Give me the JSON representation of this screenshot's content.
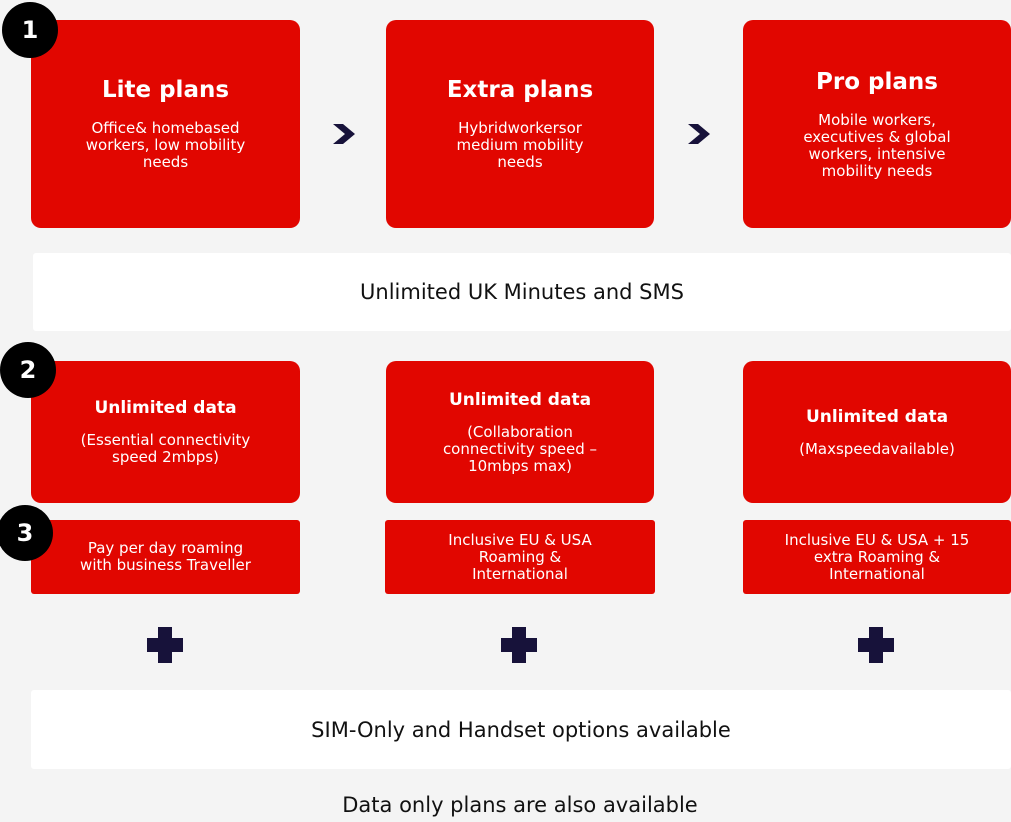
{
  "steps": [
    "1",
    "2",
    "3"
  ],
  "plans": [
    {
      "title": "Lite plans",
      "lines": [
        "Office& homebased",
        "workers, low mobility",
        "needs"
      ]
    },
    {
      "title": "Extra plans",
      "lines": [
        "Hybridworkersor",
        "medium mobility",
        "needs"
      ]
    },
    {
      "title": "Pro plans",
      "lines": [
        "Mobile workers,",
        "executives & global",
        "workers, intensive",
        "mobility needs"
      ]
    }
  ],
  "minutes_banner": "Unlimited UK Minutes and SMS",
  "data_tiers": [
    {
      "title": "Unlimited data",
      "lines": [
        "(Essential connectivity",
        "speed 2mbps)"
      ]
    },
    {
      "title": "Unlimited data",
      "lines": [
        "(Collaboration",
        "connectivity speed –",
        "10mbps max)"
      ]
    },
    {
      "title": "Unlimited data",
      "lines": [
        "(Maxspeedavailable)"
      ]
    }
  ],
  "roaming": [
    {
      "lines": [
        "Pay per day roaming",
        "with business Traveller"
      ]
    },
    {
      "lines": [
        "Inclusive EU & USA",
        "Roaming &",
        "International"
      ]
    },
    {
      "lines": [
        "Inclusive EU & USA + 15",
        "extra Roaming &",
        "International"
      ]
    }
  ],
  "options_banner": "SIM-Only and Handset options available",
  "footer": "Data only plans are also available",
  "colors": {
    "brand_red": "#e10600",
    "navy": "#17123a",
    "circle": "#000000"
  }
}
